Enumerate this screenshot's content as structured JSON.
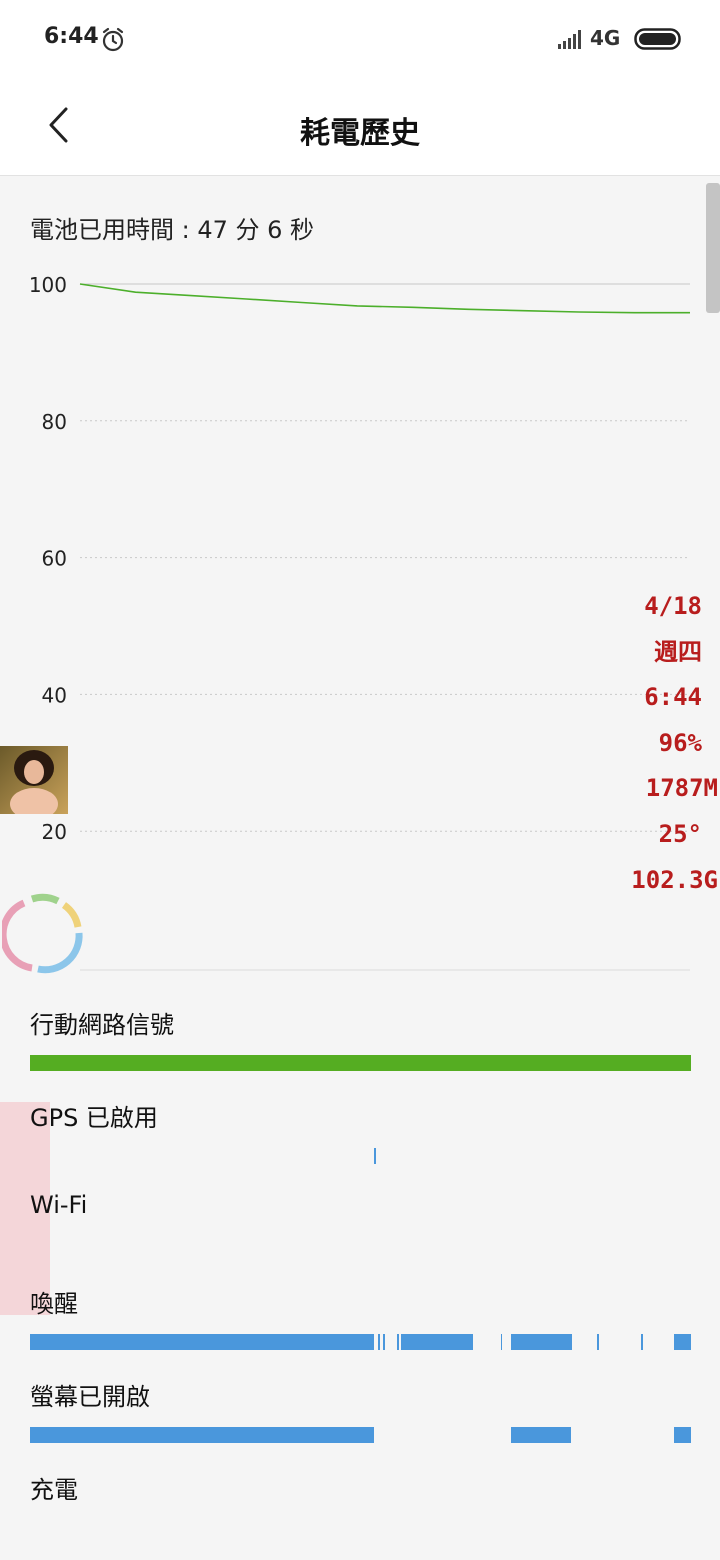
{
  "status_bar": {
    "time": "6:44",
    "network": "4G",
    "icons": [
      "alarm-icon",
      "signal-icon",
      "battery-icon"
    ]
  },
  "header": {
    "title": "耗電歷史",
    "back_icon": "chevron-left-icon"
  },
  "usage": {
    "label": "電池已用時間 : 47 分 6 秒"
  },
  "chart_data": {
    "type": "line",
    "y_ticks": [
      "100",
      "80",
      "60",
      "40",
      "20"
    ],
    "ylim": [
      0,
      100
    ],
    "grid": true,
    "line_color": "#4caf2b",
    "series": [
      {
        "values": [
          100,
          98.8,
          98.3,
          97.8,
          97.3,
          96.8,
          96.6,
          96.3,
          96.1,
          95.9,
          95.8,
          95.8
        ]
      }
    ]
  },
  "overlay": {
    "date": "4/18",
    "weekday": "週四",
    "time": "6:44",
    "battery": "96%",
    "memory": "1787M",
    "temperature": "25°",
    "storage": "102.3G",
    "color": "#b81d1d"
  },
  "signals": {
    "colors": {
      "green": "#55ad22",
      "blue": "#4a97dc"
    },
    "rows": [
      {
        "label": "行動網路信號",
        "color": "#55ad22",
        "segments": [
          [
            0,
            1
          ]
        ]
      },
      {
        "label": "GPS 已啟用",
        "color": "#4a97dc",
        "segments": [
          [
            0.52,
            0.523
          ]
        ]
      },
      {
        "label": "Wi-Fi",
        "color": "#4a97dc",
        "segments": []
      },
      {
        "label": "喚醒",
        "color": "#4a97dc",
        "segments": [
          [
            0,
            0.52
          ],
          [
            0.527,
            0.53
          ],
          [
            0.534,
            0.537
          ],
          [
            0.555,
            0.558
          ],
          [
            0.562,
            0.67
          ],
          [
            0.712,
            0.714
          ],
          [
            0.728,
            0.82
          ],
          [
            0.858,
            0.86
          ],
          [
            0.925,
            0.927
          ],
          [
            0.975,
            1
          ]
        ]
      },
      {
        "label": "螢幕已開啟",
        "color": "#4a97dc",
        "segments": [
          [
            0,
            0.52
          ],
          [
            0.728,
            0.818
          ],
          [
            0.975,
            1
          ]
        ]
      },
      {
        "label": "充電",
        "color": "#4a97dc",
        "segments": []
      }
    ]
  }
}
